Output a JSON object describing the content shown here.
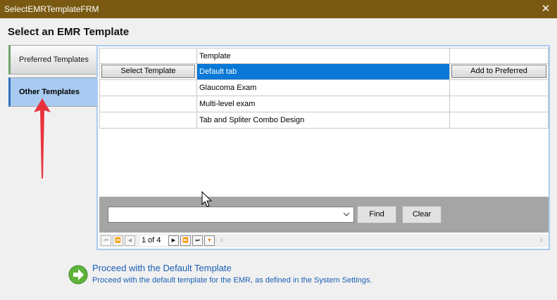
{
  "window": {
    "title": "SelectEMRTemplateFRM",
    "close_glyph": "✕"
  },
  "heading": "Select an EMR Template",
  "tabs": {
    "preferred": "Preferred Templates",
    "other": "Other Templates"
  },
  "grid": {
    "column_header": "Template",
    "rows": [
      {
        "template": "Default tab",
        "select_label": "Select Template",
        "add_label": "Add to Preferred",
        "selected": true
      },
      {
        "template": "Glaucoma Exam"
      },
      {
        "template": "Multi-level exam"
      },
      {
        "template": "Tab and Spliter Combo Design"
      }
    ]
  },
  "filter": {
    "combo_value": "",
    "find_label": "Find",
    "clear_label": "Clear"
  },
  "pager": {
    "page_info": "1 of 4",
    "icons": [
      "first-page-icon",
      "prev-group-icon",
      "prev-page-icon",
      "next-page-icon",
      "next-group-icon",
      "last-page-icon",
      "filter-icon"
    ]
  },
  "proceed": {
    "title": "Proceed with the Default Template",
    "description": "Proceed with the default template for the EMR, as defined in the System Settings."
  },
  "colors": {
    "titlebar": "#7a5a12",
    "selected_row": "#0a78d7",
    "active_tab": "#a9cbf1",
    "link": "#1a5fb4",
    "annotation_arrow": "#e8323c"
  }
}
